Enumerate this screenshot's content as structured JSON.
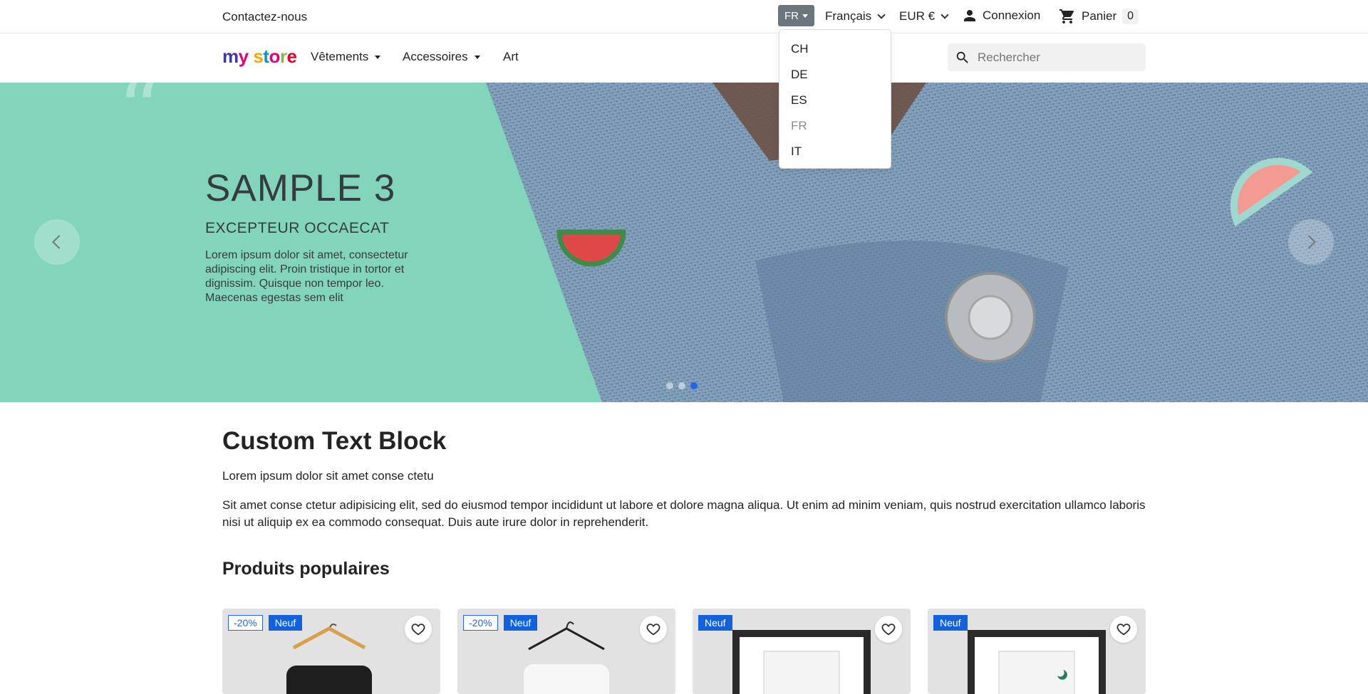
{
  "topbar": {
    "contact": "Contactez-nous",
    "lang_code": "FR",
    "language": "Français",
    "currency": "EUR €",
    "login": "Connexion",
    "cart_label": "Panier",
    "cart_count": "0"
  },
  "lang_dropdown": [
    "CH",
    "DE",
    "ES",
    "FR",
    "IT"
  ],
  "lang_dropdown_active": "FR",
  "header": {
    "logo_text": "my store",
    "nav": [
      "Vêtements",
      "Accessoires",
      "Art"
    ],
    "search_placeholder": "Rechercher"
  },
  "hero": {
    "title": "SAMPLE 3",
    "subtitle": "EXCEPTEUR OCCAECAT",
    "description": "Lorem ipsum dolor sit amet, consectetur adipiscing elit. Proin tristique in tortor et dignissim. Quisque non tempor leo. Maecenas egestas sem elit",
    "slides": 3,
    "active_slide": 3
  },
  "custom_text": {
    "title": "Custom Text Block",
    "lead": "Lorem ipsum dolor sit amet conse ctetu",
    "body": "Sit amet conse ctetur adipisicing elit, sed do eiusmod tempor incididunt ut labore et dolore magna aliqua. Ut enim ad minim veniam, quis nostrud exercitation ullamco laboris nisi ut aliquip ex ea commodo consequat. Duis aute irure dolor in reprehenderit."
  },
  "products_title": "Produits populaires",
  "products": [
    {
      "discount": "-20%",
      "badge": "Neuf"
    },
    {
      "discount": "-20%",
      "badge": "Neuf"
    },
    {
      "discount": "",
      "badge": "Neuf"
    },
    {
      "discount": "",
      "badge": "Neuf"
    }
  ],
  "colors": {
    "accent": "#2563eb",
    "hero_bg": "#82d5bb",
    "badge_new": "#1262e0"
  }
}
